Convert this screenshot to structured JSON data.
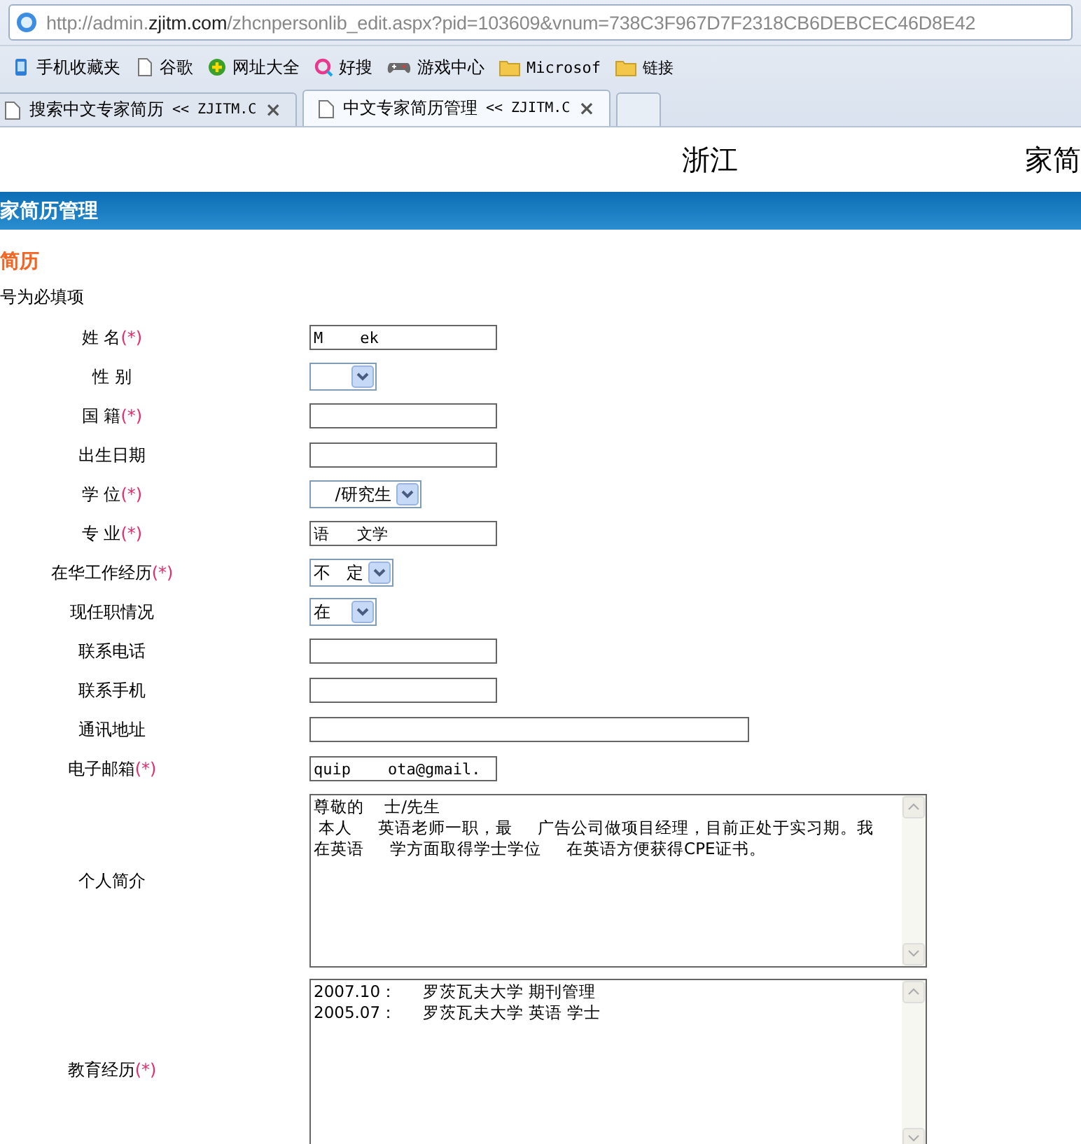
{
  "address_bar": {
    "prefix": "http://admin.",
    "host": "zjitm.com",
    "path": "/zhcnpersonlib_edit.aspx?pid=103609&vnum=738C3F967D7F2318CB6DEBCEC46D8E42"
  },
  "bookmarks": [
    {
      "label": "手机收藏夹",
      "kind": "phone"
    },
    {
      "label": "谷歌",
      "kind": "page"
    },
    {
      "label": "网址大全",
      "kind": "plus"
    },
    {
      "label": "好搜",
      "kind": "search"
    },
    {
      "label": "游戏中心",
      "kind": "gamepad"
    },
    {
      "label": "Microsof",
      "kind": "folder"
    },
    {
      "label": "链接",
      "kind": "folder"
    }
  ],
  "tabs": [
    {
      "title": "搜索中文专家简历",
      "site": "<< ZJITM.C",
      "close": "×",
      "selected": false
    },
    {
      "title": "中文专家简历管理",
      "site": "<< ZJITM.C",
      "close": "×",
      "selected": true
    }
  ],
  "site_header": {
    "title_start": "浙江",
    "title_end": "家简"
  },
  "banner": "家简历管理",
  "section_title": "简历",
  "note": "号为必填项",
  "required_mark": "(*)",
  "fields": [
    {
      "label": "姓 名",
      "required": true,
      "kind": "text",
      "value": "M    ek"
    },
    {
      "label": "性 别",
      "required": false,
      "kind": "select"
    },
    {
      "label": "国 籍",
      "required": true,
      "kind": "text"
    },
    {
      "label": "出生日期",
      "required": false,
      "kind": "text"
    },
    {
      "label": "学 位",
      "required": true,
      "kind": "select",
      "value": "    /研究生"
    },
    {
      "label": "专 业",
      "required": true,
      "kind": "text",
      "value": "语   文学"
    },
    {
      "label": "在华工作经历",
      "required": true,
      "kind": "select",
      "value": "不   定"
    },
    {
      "label": "现任职情况",
      "required": false,
      "kind": "select",
      "value": "在"
    },
    {
      "label": "联系电话",
      "required": false,
      "kind": "text"
    },
    {
      "label": "联系手机",
      "required": false,
      "kind": "text"
    },
    {
      "label": "通讯地址",
      "required": false,
      "kind": "long_text"
    },
    {
      "label": "电子邮箱",
      "required": true,
      "kind": "text",
      "value": "quip    ota@gmail."
    },
    {
      "label": "个人简介",
      "required": false,
      "kind": "textarea",
      "lines": [
        "尊敬的    士/先生",
        " 本人     英语老师一职，最     广告公司做项目经理，目前正处于实习期。我",
        "在英语     学方面取得学士学位     在英语方便获得CPE证书。"
      ]
    },
    {
      "label": "教育经历",
      "required": true,
      "kind": "textarea",
      "lines": [
        "2007.10：     罗茨瓦夫大学 期刊管理",
        "2005.07：     罗茨瓦夫大学 英语 学士"
      ]
    }
  ]
}
